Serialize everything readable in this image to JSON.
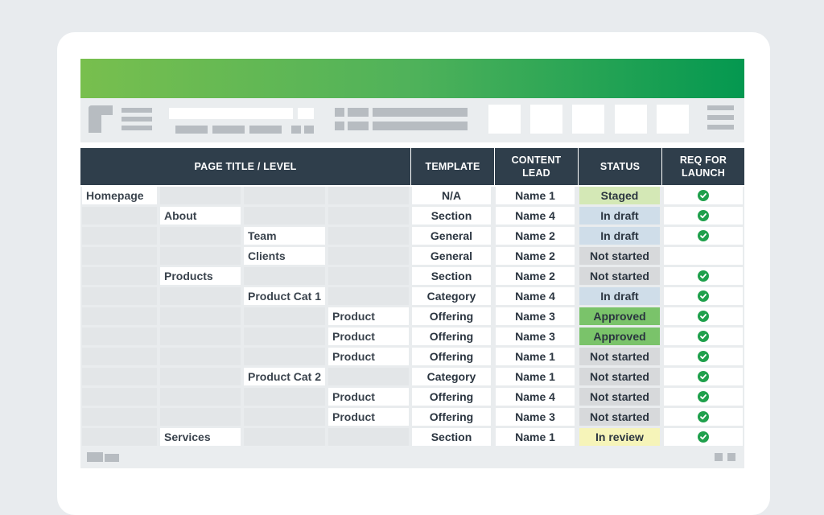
{
  "table": {
    "headers": {
      "page_title": "PAGE TITLE / LEVEL",
      "template": "TEMPLATE",
      "content_lead": "CONTENT\nLEAD",
      "status": "STATUS",
      "req_for_launch": "REQ FOR\nLAUNCH"
    },
    "rows": [
      {
        "level": 0,
        "title": "Homepage",
        "template": "N/A",
        "lead": "Name 1",
        "status": "Staged",
        "req": true
      },
      {
        "level": 1,
        "title": "About",
        "template": "Section",
        "lead": "Name 4",
        "status": "In draft",
        "req": true
      },
      {
        "level": 2,
        "title": "Team",
        "template": "General",
        "lead": "Name 2",
        "status": "In draft",
        "req": true
      },
      {
        "level": 2,
        "title": "Clients",
        "template": "General",
        "lead": "Name 2",
        "status": "Not started",
        "req": false
      },
      {
        "level": 1,
        "title": "Products",
        "template": "Section",
        "lead": "Name 2",
        "status": "Not started",
        "req": true
      },
      {
        "level": 2,
        "title": "Product Cat 1",
        "template": "Category",
        "lead": "Name 4",
        "status": "In draft",
        "req": true
      },
      {
        "level": 3,
        "title": "Product",
        "template": "Offering",
        "lead": "Name 3",
        "status": "Approved",
        "req": true
      },
      {
        "level": 3,
        "title": "Product",
        "template": "Offering",
        "lead": "Name 3",
        "status": "Approved",
        "req": true
      },
      {
        "level": 3,
        "title": "Product",
        "template": "Offering",
        "lead": "Name 1",
        "status": "Not started",
        "req": true
      },
      {
        "level": 2,
        "title": "Product Cat 2",
        "template": "Category",
        "lead": "Name 1",
        "status": "Not started",
        "req": true
      },
      {
        "level": 3,
        "title": "Product",
        "template": "Offering",
        "lead": "Name 4",
        "status": "Not started",
        "req": true
      },
      {
        "level": 3,
        "title": "Product",
        "template": "Offering",
        "lead": "Name 3",
        "status": "Not started",
        "req": true
      },
      {
        "level": 1,
        "title": "Services",
        "template": "Section",
        "lead": "Name 1",
        "status": "In review",
        "req": true
      }
    ]
  },
  "status_colors": {
    "Staged": "#d4e8b6",
    "In draft": "#cfdde9",
    "Not started": "#d7d9db",
    "Approved": "#7ac36a",
    "In review": "#f6f4b9"
  },
  "icons": {
    "check": "check-circle-icon",
    "menu": "hamburger-menu-icon",
    "logo": "logo-icon"
  }
}
